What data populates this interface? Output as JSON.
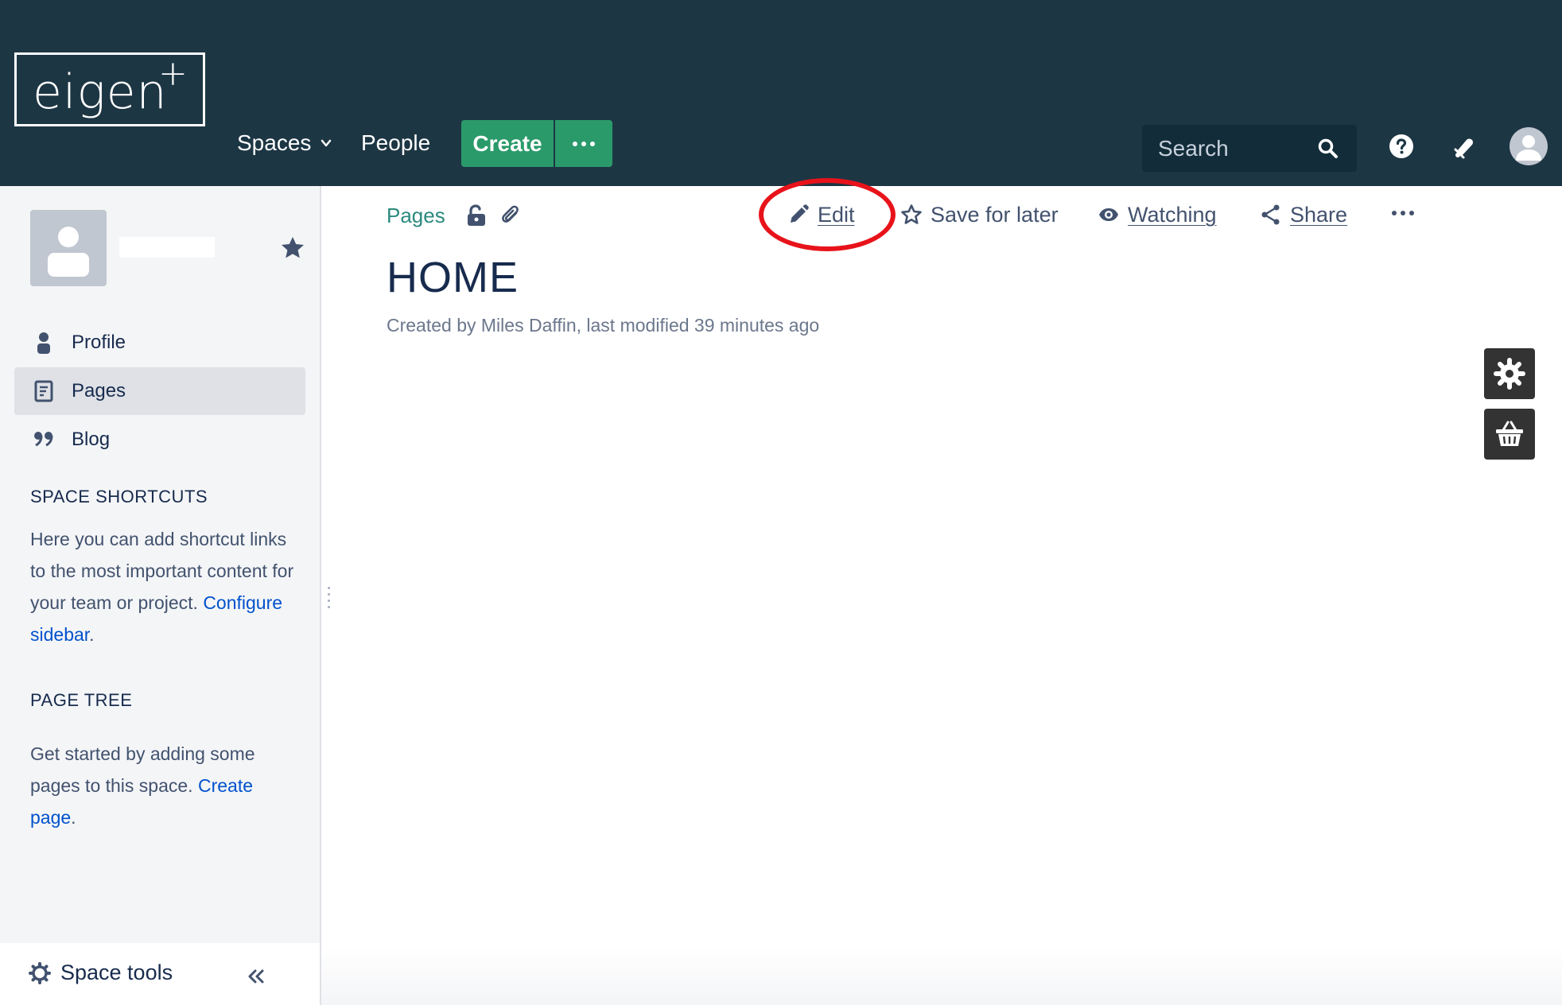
{
  "header": {
    "logo_text": "eigen",
    "logo_plus": "+",
    "nav": {
      "spaces": "Spaces",
      "people": "People"
    },
    "create_label": "Create",
    "search_placeholder": "Search"
  },
  "sidebar": {
    "nav": [
      {
        "label": "Profile",
        "icon": "person-icon",
        "active": false
      },
      {
        "label": "Pages",
        "icon": "page-icon",
        "active": true
      },
      {
        "label": "Blog",
        "icon": "quote-icon",
        "active": false
      }
    ],
    "shortcuts": {
      "heading": "SPACE SHORTCUTS",
      "text": "Here you can add shortcut links to the most important content for your team or project.",
      "link": "Configure sidebar",
      "suffix": "."
    },
    "page_tree": {
      "heading": "PAGE TREE",
      "text": "Get started by adding some pages to this space.",
      "link": "Create page",
      "suffix": "."
    },
    "space_tools": "Space tools"
  },
  "page": {
    "breadcrumb": "Pages",
    "actions": {
      "edit": "Edit",
      "save": "Save for later",
      "watching": "Watching",
      "share": "Share"
    },
    "title": "HOME",
    "byline": "Created by Miles Daffin, last modified 39 minutes ago"
  },
  "colors": {
    "header_bg": "#1d3644",
    "create_green": "#2b9a6a",
    "breadcrumb_teal": "#2b8a7e",
    "link_blue": "#0052cc",
    "highlight_red": "#e8131a"
  }
}
